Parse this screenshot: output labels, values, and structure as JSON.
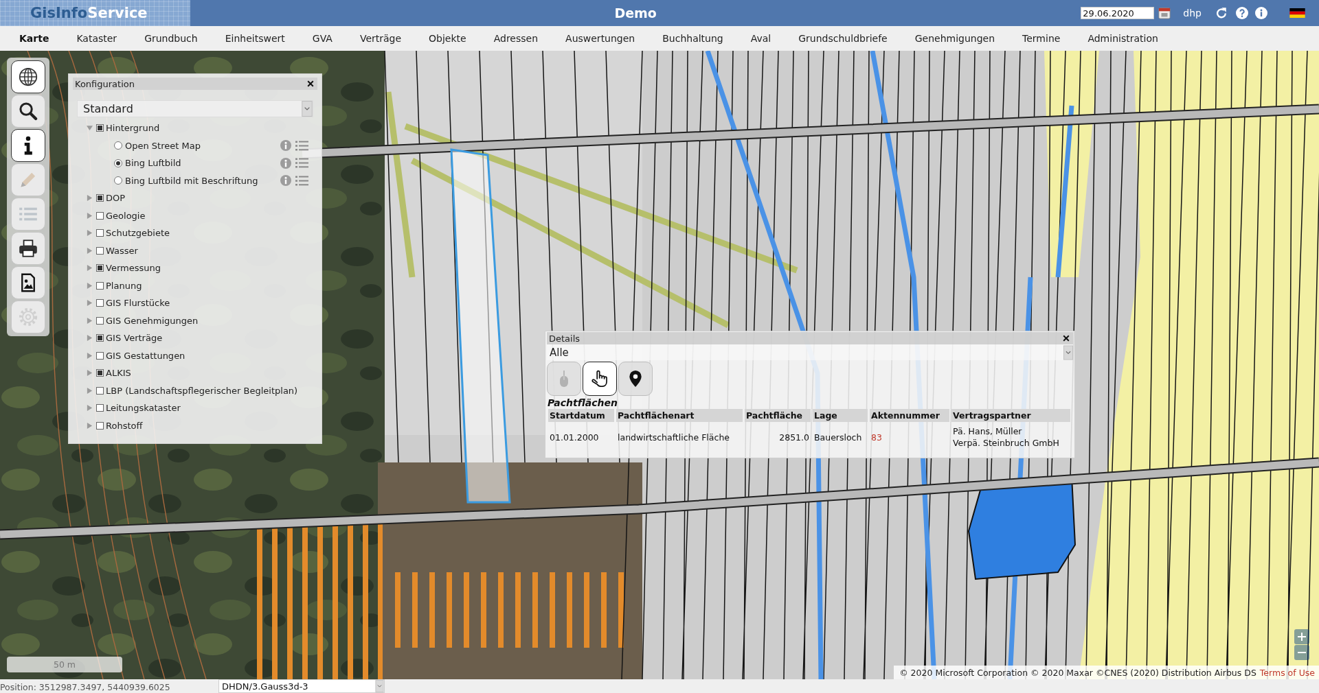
{
  "header": {
    "logo": {
      "dark": "GisInfo",
      "light": "Service"
    },
    "title": "Demo",
    "date": "29.06.2020",
    "user": "dhp"
  },
  "menu": [
    {
      "label": "Karte",
      "selected": true
    },
    {
      "label": "Kataster",
      "selected": false
    },
    {
      "label": "Grundbuch",
      "selected": false
    },
    {
      "label": "Einheitswert",
      "selected": false
    },
    {
      "label": "GVA",
      "selected": false
    },
    {
      "label": "Verträge",
      "selected": false
    },
    {
      "label": "Objekte",
      "selected": false
    },
    {
      "label": "Adressen",
      "selected": false
    },
    {
      "label": "Auswertungen",
      "selected": false
    },
    {
      "label": "Buchhaltung",
      "selected": false
    },
    {
      "label": "Aval",
      "selected": false
    },
    {
      "label": "Grundschuldbriefe",
      "selected": false
    },
    {
      "label": "Genehmigungen",
      "selected": false
    },
    {
      "label": "Termine",
      "selected": false
    },
    {
      "label": "Administration",
      "selected": false
    }
  ],
  "toolbar": [
    {
      "kind": "globe",
      "active": true,
      "disabled": false
    },
    {
      "kind": "search",
      "active": false,
      "disabled": false
    },
    {
      "kind": "info",
      "active": true,
      "disabled": false
    },
    {
      "kind": "pencil",
      "active": false,
      "disabled": true
    },
    {
      "kind": "list",
      "active": false,
      "disabled": true
    },
    {
      "kind": "print",
      "active": false,
      "disabled": false
    },
    {
      "kind": "image",
      "active": false,
      "disabled": false
    },
    {
      "kind": "gear",
      "active": false,
      "disabled": true
    }
  ],
  "configuration": {
    "title": "Konfiguration",
    "profile": "Standard",
    "layers": [
      {
        "label": "Hintergrund",
        "checked": true,
        "expanded": true,
        "children": [
          {
            "label": "Open Street Map",
            "selected": false
          },
          {
            "label": "Bing Luftbild",
            "selected": true
          },
          {
            "label": "Bing Luftbild mit Beschriftung",
            "selected": false
          }
        ]
      },
      {
        "label": "DOP",
        "checked": true,
        "expanded": false
      },
      {
        "label": "Geologie",
        "checked": false,
        "expanded": false
      },
      {
        "label": "Schutzgebiete",
        "checked": false,
        "expanded": false
      },
      {
        "label": "Wasser",
        "checked": false,
        "expanded": false
      },
      {
        "label": "Vermessung",
        "checked": true,
        "expanded": false
      },
      {
        "label": "Planung",
        "checked": false,
        "expanded": false
      },
      {
        "label": "GIS Flurstücke",
        "checked": false,
        "expanded": false
      },
      {
        "label": "GIS Genehmigungen",
        "checked": false,
        "expanded": false
      },
      {
        "label": "GIS Verträge",
        "checked": true,
        "expanded": false
      },
      {
        "label": "GIS Gestattungen",
        "checked": false,
        "expanded": false
      },
      {
        "label": "ALKIS",
        "checked": true,
        "expanded": false
      },
      {
        "label": "LBP (Landschaftspflegerischer Begleitplan)",
        "checked": false,
        "expanded": false
      },
      {
        "label": "Leitungskataster",
        "checked": false,
        "expanded": false
      },
      {
        "label": "Rohstoff",
        "checked": false,
        "expanded": false
      }
    ]
  },
  "details": {
    "title": "Details",
    "filter": "Alle",
    "tools": [
      {
        "kind": "mouse",
        "active": false,
        "disabled": true
      },
      {
        "kind": "hand",
        "active": true,
        "disabled": false
      },
      {
        "kind": "marker",
        "active": false,
        "disabled": false
      }
    ],
    "section": "Pachtflächen",
    "table": {
      "columns": [
        "Startdatum",
        "Pachtflächenart",
        "Pachtfläche",
        "Lage",
        "Aktennummer",
        "Vertragspartner"
      ],
      "rows": [
        {
          "cells": [
            {
              "kind": "text",
              "text": "01.01.2000"
            },
            {
              "kind": "text",
              "text": "landwirtschaftliche Fläche"
            },
            {
              "kind": "number",
              "text": "2851.0"
            },
            {
              "kind": "text",
              "text": "Bauersloch"
            },
            {
              "kind": "link",
              "text": "83"
            },
            {
              "kind": "lines",
              "lines": [
                "Pä. Hans, Müller",
                "Verpä. Steinbruch GmbH"
              ]
            }
          ]
        }
      ]
    }
  },
  "map": {
    "scale": "50 m",
    "attribution": "© 2020 Microsoft Corporation © 2020 Maxar ©CNES (2020) Distribution Airbus DS",
    "terms_link": "Terms of Use"
  },
  "status_bar": {
    "position": "Position: 3512987.3497, 5440939.6025",
    "projection": "DHDN/3.Gauss3d-3"
  }
}
